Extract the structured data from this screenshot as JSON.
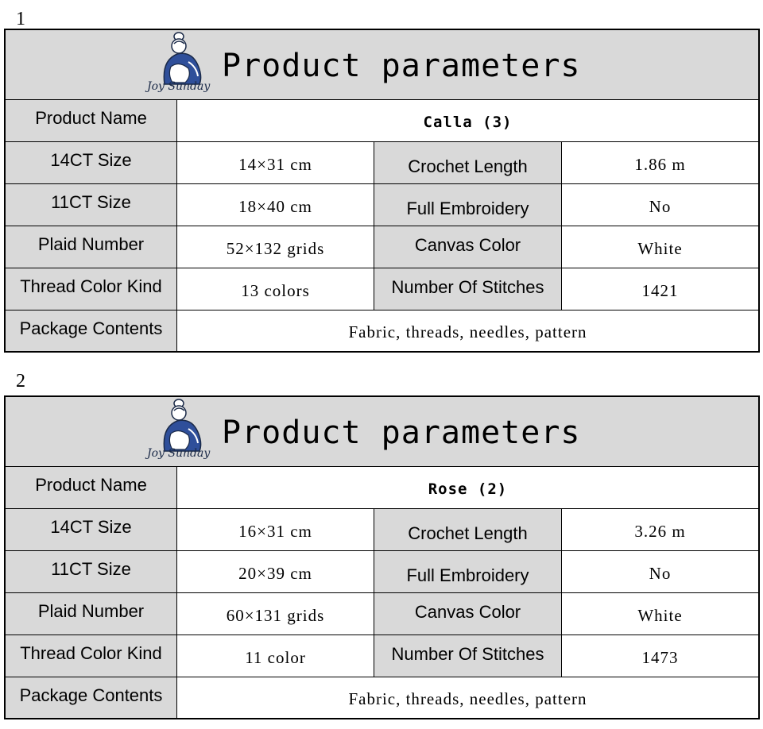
{
  "tables": [
    {
      "number": "1",
      "title": "Product parameters",
      "logo_text": "Joy Sunday",
      "product_name_label": "Product Name",
      "product_name": "Calla (3)",
      "rows": [
        {
          "label": "14CT  Size",
          "value": "14×31 cm",
          "label2": "Crochet Length",
          "value2": "1.86 m"
        },
        {
          "label": "11CT  Size",
          "value": "18×40 cm",
          "label2": "Full Embroidery",
          "value2": "No"
        },
        {
          "label": "Plaid Number",
          "value": "52×132 grids",
          "label2": "Canvas Color",
          "value2": "White"
        },
        {
          "label": "Thread Color Kind",
          "value": "13 colors",
          "label2": "Number Of Stitches",
          "value2": "1421"
        }
      ],
      "package_label": "Package Contents",
      "package_value": "Fabric, threads, needles, pattern"
    },
    {
      "number": "2",
      "title": "Product parameters",
      "logo_text": "Joy Sunday",
      "product_name_label": "Product Name",
      "product_name": "Rose (2)",
      "rows": [
        {
          "label": "14CT  Size",
          "value": "16×31 cm",
          "label2": "Crochet Length",
          "value2": "3.26 m"
        },
        {
          "label": "11CT  Size",
          "value": "20×39 cm",
          "label2": "Full Embroidery",
          "value2": "No"
        },
        {
          "label": "Plaid Number",
          "value": "60×131 grids",
          "label2": "Canvas Color",
          "value2": "White"
        },
        {
          "label": "Thread Color Kind",
          "value": "11 color",
          "label2": "Number Of Stitches",
          "value2": "1473"
        }
      ],
      "package_label": "Package Contents",
      "package_value": "Fabric, threads, needles, pattern"
    }
  ]
}
